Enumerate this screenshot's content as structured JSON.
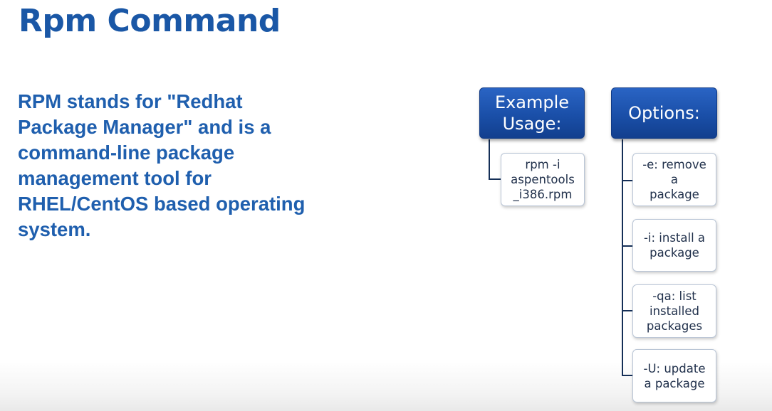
{
  "title": "Rpm Command",
  "description": "RPM stands for \"Redhat Package Manager\" and is a command-line package management tool for RHEL/CentOS based operating system.",
  "diagram": {
    "example": {
      "header": "Example\nUsage:",
      "items": [
        "rpm -i\naspentools\n_i386.rpm"
      ]
    },
    "options": {
      "header": "Options:",
      "items": [
        "-e: remove\na\npackage",
        "-i: install a\npackage",
        "-qa: list\ninstalled\npackages",
        "-U: update\na package"
      ]
    }
  }
}
